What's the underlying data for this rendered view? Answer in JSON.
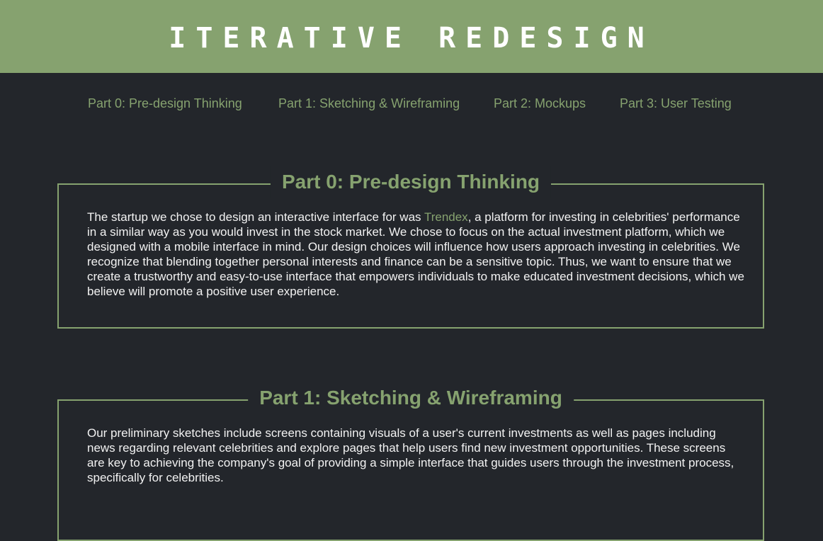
{
  "header": {
    "title": "Iterative Redesign"
  },
  "nav": {
    "items": [
      {
        "label": "Part 0: Pre-design Thinking"
      },
      {
        "label": "Part 1: Sketching & Wireframing"
      },
      {
        "label": "Part 2: Mockups"
      },
      {
        "label": "Part 3: User Testing"
      }
    ]
  },
  "sections": [
    {
      "title": "Part 0: Pre-design Thinking",
      "body_before": "The startup we chose to design an interactive interface for was ",
      "link": "Trendex",
      "body_after": ", a platform for investing in celebrities' performance in a similar way as you would invest in the stock market. We chose to focus on the actual investment platform, which we designed with a mobile interface in mind. Our design choices will influence how users approach investing in celebrities. We recognize that blending together personal interests and finance can be a sensitive topic. Thus, we want to ensure that we create a trustworthy and easy-to-use interface that empowers individuals to make educated investment decisions, which we believe will promote a positive user experience."
    },
    {
      "title": "Part 1: Sketching & Wireframing",
      "body": "Our preliminary sketches include screens containing visuals of a user's current investments as well as pages including news regarding relevant celebrities and explore pages that help users find new investment opportunities. These screens are key to achieving the company's goal of providing a simple interface that guides users through the investment process, specifically for celebrities."
    }
  ],
  "colors": {
    "accent": "#86a26f",
    "background": "#23262b",
    "text": "#f2f2f2"
  }
}
